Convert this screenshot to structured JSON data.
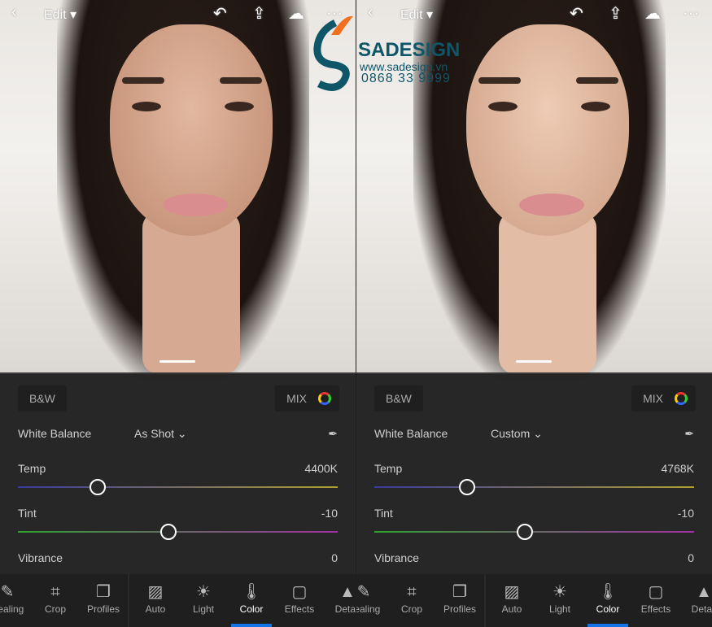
{
  "header": {
    "back_icon": "chevron-left-icon",
    "edit_label": "Edit",
    "icons": [
      "undo-icon",
      "share-icon",
      "cloud-add-icon",
      "more-icon"
    ]
  },
  "panels": [
    {
      "bw_label": "B&W",
      "mix_label": "MIX",
      "wb_label": "White Balance",
      "wb_value": "As Shot",
      "temp_label": "Temp",
      "temp_value": "4400K",
      "temp_pos": 0.25,
      "tint_label": "Tint",
      "tint_value": "-10",
      "tint_pos": 0.47,
      "vibrance_label": "Vibrance",
      "vibrance_value": "0"
    },
    {
      "bw_label": "B&W",
      "mix_label": "MIX",
      "wb_label": "White Balance",
      "wb_value": "Custom",
      "temp_label": "Temp",
      "temp_value": "4768K",
      "temp_pos": 0.29,
      "tint_label": "Tint",
      "tint_value": "-10",
      "tint_pos": 0.47,
      "vibrance_label": "Vibrance",
      "vibrance_value": "0"
    }
  ],
  "tools": [
    {
      "label": "Healing",
      "icon": "bandage-icon"
    },
    {
      "label": "Crop",
      "icon": "crop-icon"
    },
    {
      "label": "Profiles",
      "icon": "profiles-icon"
    },
    {
      "label": "Auto",
      "icon": "auto-icon"
    },
    {
      "label": "Light",
      "icon": "sun-icon"
    },
    {
      "label": "Color",
      "icon": "thermometer-icon",
      "active": true
    },
    {
      "label": "Effects",
      "icon": "effects-icon"
    },
    {
      "label": "Detail",
      "icon": "detail-icon"
    }
  ],
  "watermark": {
    "brand": "SADESIGN",
    "url": "www.sadesign.vn",
    "phone": "0868 33 9999"
  },
  "colors": {
    "accent": "#1473e6"
  }
}
